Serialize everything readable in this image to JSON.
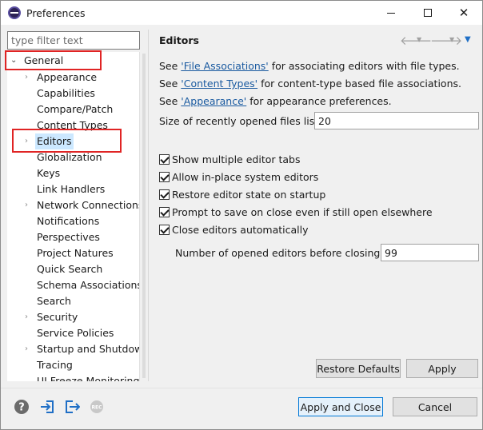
{
  "window": {
    "title": "Preferences"
  },
  "filter": {
    "placeholder": "type filter text"
  },
  "tree": {
    "items": [
      {
        "label": "General",
        "arrow": "expanded"
      },
      {
        "label": "Appearance",
        "arrow": "collapsed"
      },
      {
        "label": "Capabilities",
        "arrow": "none"
      },
      {
        "label": "Compare/Patch",
        "arrow": "none"
      },
      {
        "label": "Content Types",
        "arrow": "none"
      },
      {
        "label": "Editors",
        "arrow": "collapsed",
        "selected": true
      },
      {
        "label": "Globalization",
        "arrow": "none"
      },
      {
        "label": "Keys",
        "arrow": "none"
      },
      {
        "label": "Link Handlers",
        "arrow": "none"
      },
      {
        "label": "Network Connections",
        "arrow": "collapsed"
      },
      {
        "label": "Notifications",
        "arrow": "none"
      },
      {
        "label": "Perspectives",
        "arrow": "none"
      },
      {
        "label": "Project Natures",
        "arrow": "none"
      },
      {
        "label": "Quick Search",
        "arrow": "none"
      },
      {
        "label": "Schema Associations",
        "arrow": "none"
      },
      {
        "label": "Search",
        "arrow": "none"
      },
      {
        "label": "Security",
        "arrow": "collapsed"
      },
      {
        "label": "Service Policies",
        "arrow": "none"
      },
      {
        "label": "Startup and Shutdown",
        "arrow": "collapsed"
      },
      {
        "label": "Tracing",
        "arrow": "none"
      },
      {
        "label": "UI Freeze Monitoring",
        "arrow": "none"
      }
    ]
  },
  "page": {
    "title": "Editors",
    "info": [
      {
        "prefix": "See ",
        "link": "'File Associations'",
        "suffix": " for associating editors with file types."
      },
      {
        "prefix": "See ",
        "link": "'Content Types'",
        "suffix": " for content-type based file associations."
      },
      {
        "prefix": "See ",
        "link": "'Appearance'",
        "suffix": " for appearance preferences."
      }
    ],
    "recent_files": {
      "label": "Size of recently opened files list:",
      "value": "20"
    },
    "checkboxes": [
      {
        "label": "Show multiple editor tabs",
        "checked": true
      },
      {
        "label": "Allow in-place system editors",
        "checked": true
      },
      {
        "label": "Restore editor state on startup",
        "checked": true
      },
      {
        "label": "Prompt to save on close even if still open elsewhere",
        "checked": true
      },
      {
        "label": "Close editors automatically",
        "checked": true
      }
    ],
    "opened_editors": {
      "label": "Number of opened editors before closing:",
      "value": "99"
    },
    "restore_defaults_label": "Restore Defaults",
    "apply_label": "Apply"
  },
  "footer": {
    "apply_close_label": "Apply and Close",
    "cancel_label": "Cancel",
    "rec_label": "REC"
  },
  "icons": {
    "help": "help-icon",
    "import": "import-icon",
    "export": "export-icon",
    "record": "record-icon",
    "back": "back-arrow-icon",
    "forward": "forward-arrow-icon",
    "menu": "view-menu-icon"
  },
  "colors": {
    "selection": "#cce8ff",
    "highlight_box": "#e02424",
    "link": "#1a5aa0",
    "accent": "#0078d7"
  }
}
